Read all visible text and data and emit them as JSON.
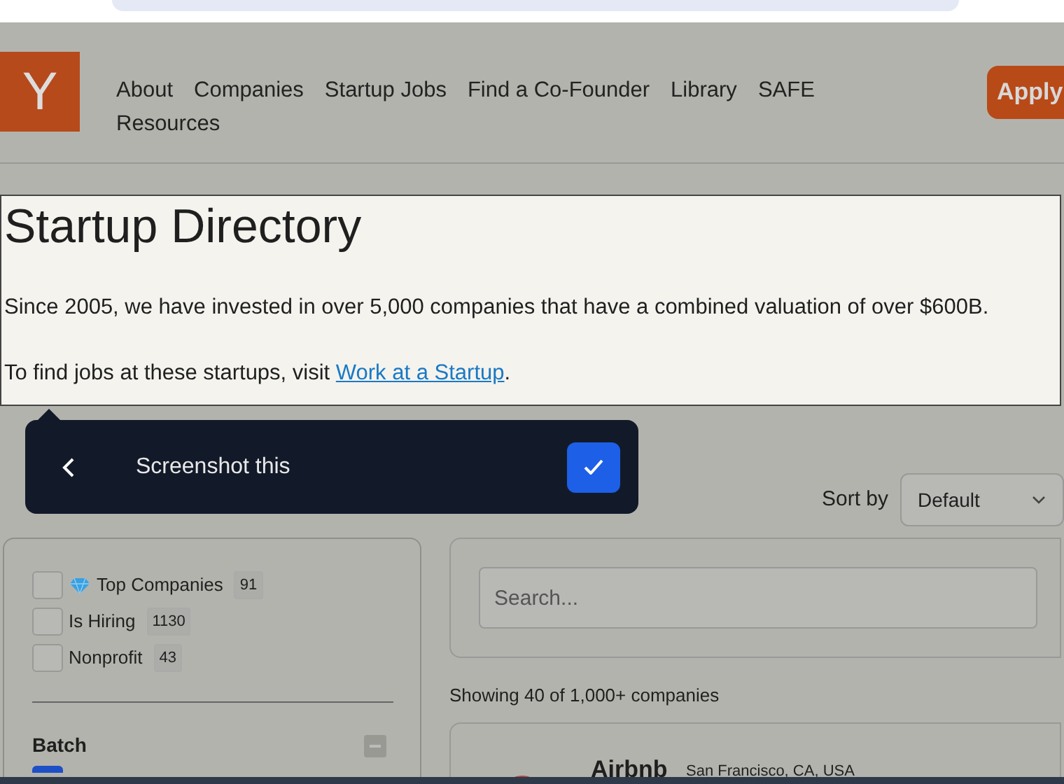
{
  "nav": {
    "logo": "Y",
    "links": [
      {
        "label": "About"
      },
      {
        "label": "Companies"
      },
      {
        "label": "Startup Jobs"
      },
      {
        "label": "Find a Co-Founder"
      },
      {
        "label": "Library"
      },
      {
        "label": "SAFE"
      },
      {
        "label": "Resources"
      }
    ],
    "apply_button": "Apply"
  },
  "header": {
    "title": "Startup Directory",
    "intro": "Since 2005, we have invested in over 5,000 companies that have a combined valuation of over $600B.",
    "jobs_text": "To find jobs at these startups, visit ",
    "jobs_link": "Work at a Startup",
    "jobs_end": "."
  },
  "popup": {
    "label": "Screenshot this"
  },
  "sort": {
    "label": "Sort by",
    "value": "Default"
  },
  "filters": [
    {
      "kind": "top",
      "label": "Top Companies",
      "count": "91",
      "checked": false
    },
    {
      "kind": "plain",
      "label": "Is Hiring",
      "count": "1130",
      "checked": false
    },
    {
      "kind": "plain",
      "label": "Nonprofit",
      "count": "43",
      "checked": false
    }
  ],
  "batch": {
    "title": "Batch",
    "expanded": true,
    "first_option_checked": true
  },
  "search": {
    "placeholder": "Search..."
  },
  "results_text": "Showing 40 of 1,000+ companies",
  "companies": [
    {
      "name": "Airbnb",
      "location": "San Francisco, CA, USA"
    }
  ]
}
